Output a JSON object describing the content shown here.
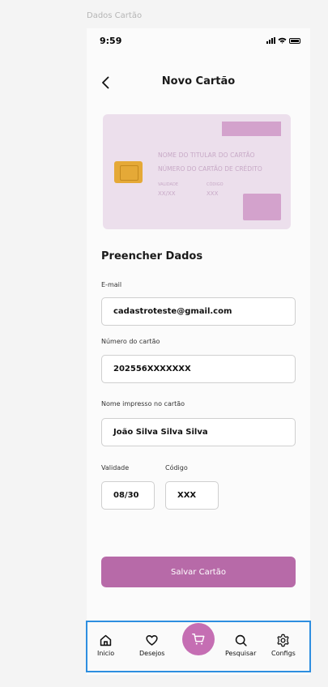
{
  "frame_label": "Dados Cartão",
  "status_bar": {
    "time": "9:59"
  },
  "header": {
    "title": "Novo Cartão"
  },
  "card_preview": {
    "holder_placeholder": "NOME DO TITULAR DO CARTÃO",
    "number_placeholder": "NÚMERO DO CARTÃO DE CRÉDITO",
    "validity_label": "VALIDADE",
    "validity_value": "XX/XX",
    "code_label": "CÓDIGO",
    "code_value": "XXX",
    "card_color": "#ecdfec",
    "accent_color": "#d3a2cc",
    "chip_color": "#e5a937"
  },
  "form": {
    "section_title": "Preencher Dados",
    "email": {
      "label": "E-mail",
      "value": "cadastroteste@gmail.com"
    },
    "card_number": {
      "label": "Número do cartão",
      "value": "202556XXXXXXX"
    },
    "printed_name": {
      "label": "Nome impresso no cartão",
      "value": "João Silva Silva Silva"
    },
    "validity": {
      "label": "Validade",
      "value": "08/30"
    },
    "code": {
      "label": "Código",
      "value": "XXX"
    }
  },
  "save_button": {
    "label": "Salvar Cartão",
    "color": "#b76aa8"
  },
  "nav": {
    "items": [
      {
        "label": "Inicio",
        "icon": "home-icon"
      },
      {
        "label": "Desejos",
        "icon": "heart-icon"
      },
      {
        "label": "",
        "icon": "cart-icon"
      },
      {
        "label": "Pesquisar",
        "icon": "search-icon"
      },
      {
        "label": "Configs",
        "icon": "gear-icon"
      }
    ],
    "cart_color": "#c56eb3",
    "highlight_color": "#2d8ee0"
  }
}
